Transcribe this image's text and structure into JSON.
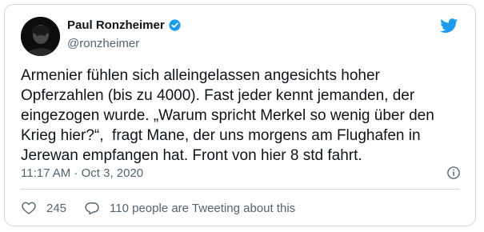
{
  "author": {
    "display_name": "Paul Ronzheimer",
    "handle": "@ronzheimer",
    "verified_icon": "verified-badge-icon",
    "avatar_icon": "avatar"
  },
  "brand": {
    "icon": "twitter-bird-icon",
    "color": "#1d9bf0"
  },
  "tweet": {
    "text": "Armenier fühlen sich alleingelassen angesichts hoher\nOpferzahlen (bis zu 4000). Fast jeder kennt jemanden, der\neingezogen wurde. „Warum spricht Merkel so wenig über den\nKrieg hier?“,  fragt Mane, der uns morgens am Flughafen in\nJerewan empfangen hat. Front von hier 8 std fahrt.",
    "timestamp": "11:17 AM · Oct 3, 2020",
    "info_icon": "info-icon"
  },
  "actions": {
    "likes_count": "245",
    "like_icon": "heart-icon",
    "conversation_label": "110 people are Tweeting about this",
    "conversation_icon": "reply-bubble-icon"
  }
}
